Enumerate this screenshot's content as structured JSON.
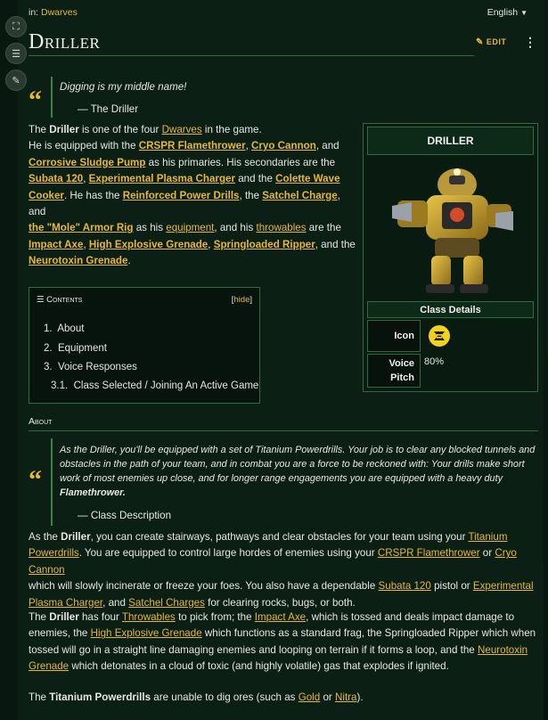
{
  "topbar": {
    "breadcrumb_prefix": "in:",
    "breadcrumb_link": "Dwarves",
    "language": "English"
  },
  "page": {
    "title": "Driller",
    "edit_label": "EDIT",
    "more": "⋮"
  },
  "quote1": {
    "text": "Digging is my middle name!",
    "attribution": "— The Driller"
  },
  "intro": {
    "p1": "The",
    "name": "Driller",
    "p2": "is one of the four",
    "dwarves": "Dwarves",
    "p3": "in the game.",
    "l2a": "He is equipped with the",
    "crspr": "CRSPR Flamethrower",
    "cryo": "Cryo Cannon",
    "and": ", and",
    "corrosive": "Corrosive Sludge Pump",
    "prim": "as his primaries. His secondaries are the",
    "subata": "Subata 120",
    "epc": "Experimental Plasma Charger",
    "and2": "and the",
    "colette": "Colette Wave",
    "cooker": "Cooker",
    "hashas": ". He has the",
    "rpd": "Reinforced Power Drills",
    "the": ", the",
    "satchel": "Satchel Charge",
    "andl": ", and",
    "armor": "the \"Mole\" Armor Rig",
    "ashis": "as his",
    "equipment": "equipment",
    "andhis": ", and his",
    "throwables": "throwables",
    "arethe": "are the",
    "impact": "Impact Axe",
    "he": "High Explosive Grenade",
    "spring": "Springloaded Ripper",
    "andthe": ", and the",
    "neuro": "Neurotoxin Grenade",
    "dot": "."
  },
  "infobox": {
    "title": "DRILLER",
    "subtitle": "Class Details",
    "icon_label": "Icon",
    "voice_label1": "Voice",
    "voice_label2": "Pitch",
    "voice_value": "80%"
  },
  "toc": {
    "heading": "Contents",
    "hide_open": "[",
    "hide": "hide",
    "hide_close": "]",
    "items": [
      {
        "num": "1.",
        "label": "About"
      },
      {
        "num": "2.",
        "label": "Equipment"
      },
      {
        "num": "3.",
        "label": "Voice Responses"
      },
      {
        "num": "3.1.",
        "label": "Class Selected / Joining An Active Game"
      }
    ]
  },
  "about": {
    "heading": "About",
    "quote_lines": [
      "As the Driller, you'll be equipped with a set of Titanium Powerdrills. Your job is to clear any blocked tunnels and",
      "obstacles in the path of your team, and in combat you are a force to be reckoned with: Your drills make short",
      "work of most enemies up close, and for longer range engagements you are equipped with a heavy duty",
      "Flamethrower."
    ],
    "quote_attr": "— Class Description",
    "p1": {
      "a": "As the",
      "driller": "Driller",
      "b": ", you can create stairways, pathways and clear obstacles for your team using your",
      "tp1": "Titanium",
      "tp2": "Powerdrills",
      "c": ". You are equipped to control large hordes of enemies using your",
      "crspr": "CRSPR Flamethrower",
      "or": "or",
      "cryo": "Cryo Cannon",
      "d": "which will slowly incinerate or freeze your foes. You also have a dependable",
      "subata": "Subata 120",
      "e": "pistol or",
      "exp1": "Experimental",
      "exp2": "Plasma Charger",
      "f": ", and",
      "satchel": "Satchel Charges",
      "g": "for clearing rocks, bugs, or both."
    },
    "p2": {
      "a": "The",
      "driller": "Driller",
      "b": "has four",
      "throwables": "Throwables",
      "c": "to pick from; the",
      "impact": "Impact Axe",
      "d": ", which is tossed and deals impact damage to",
      "e": "enemies, the",
      "he": "High Explosive Grenade",
      "f": "which functions as a standard frag, the Springloaded Ripper which when",
      "g": "tossed will go in a straight line damaging enemies and looping on terrain if it forms a loop, and the",
      "neuro1": "Neurotoxin",
      "neuro2": "Grenade",
      "h": "which detonates in a cloud of toxic (and highly volatile) gas that explodes if ignited."
    },
    "p3": {
      "a": "The",
      "tp": "Titanium Powerdrills",
      "b": "are unable to dig ores (such as",
      "gold": "Gold",
      "or": "or",
      "nitra": "Nitra",
      "c": ")."
    }
  }
}
